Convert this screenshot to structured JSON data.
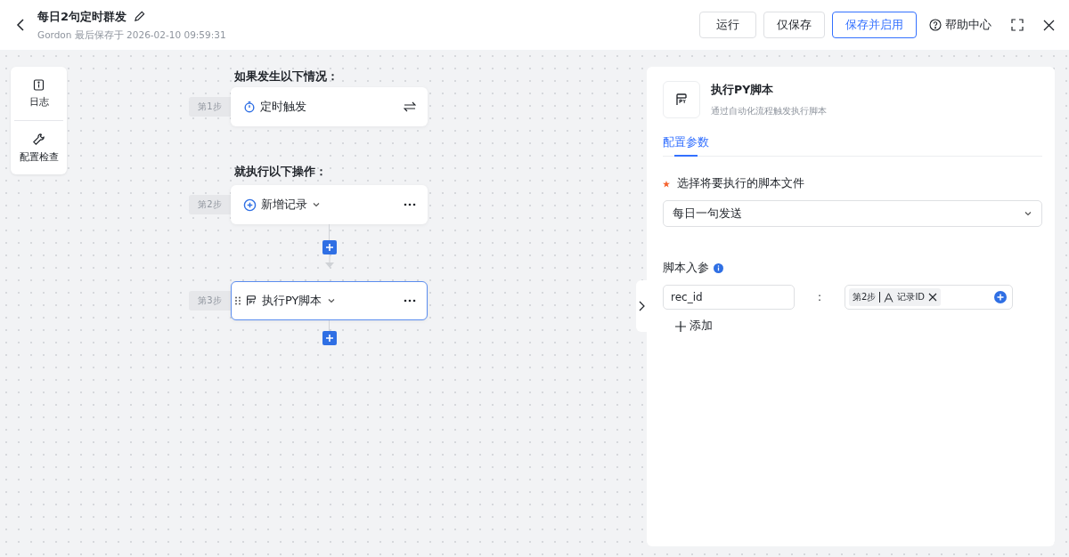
{
  "header": {
    "title": "每日2句定时群发",
    "subtitle": "Gordon 最后保存于 2026-02-10 09:59:31",
    "help": "帮助中心",
    "buttons": [
      {
        "label": "运行",
        "kind": "default"
      },
      {
        "label": "仅保存",
        "kind": "default"
      },
      {
        "label": "保存并启用",
        "kind": "primary"
      }
    ]
  },
  "tools": [
    {
      "label": "日志",
      "kind": "log"
    },
    {
      "label": "配置检查",
      "kind": "check"
    }
  ],
  "flow": {
    "trigger_heading": "如果发生以下情况：",
    "action_heading": "就执行以下操作：",
    "steps": [
      {
        "step": "第1步",
        "label": "定时触发",
        "kind": "trigger",
        "selected": false
      },
      {
        "step": "第2步",
        "label": "新增记录",
        "kind": "action",
        "selected": false
      },
      {
        "step": "第3步",
        "label": "执行PY脚本",
        "kind": "script",
        "selected": true
      }
    ]
  },
  "panel": {
    "title": "执行PY脚本",
    "description": "通过自动化流程触发执行脚本",
    "tabs": [
      {
        "label": "配置参数",
        "selected": true
      }
    ],
    "file_label": "选择将要执行的脚本文件",
    "required": true,
    "file_value": "每日一句发送",
    "params_label": "脚本入参",
    "params": [
      {
        "name": "rec_id",
        "separator": ":",
        "token_step": "第2步",
        "token_field": "记录ID"
      }
    ],
    "add_label": "添加"
  }
}
